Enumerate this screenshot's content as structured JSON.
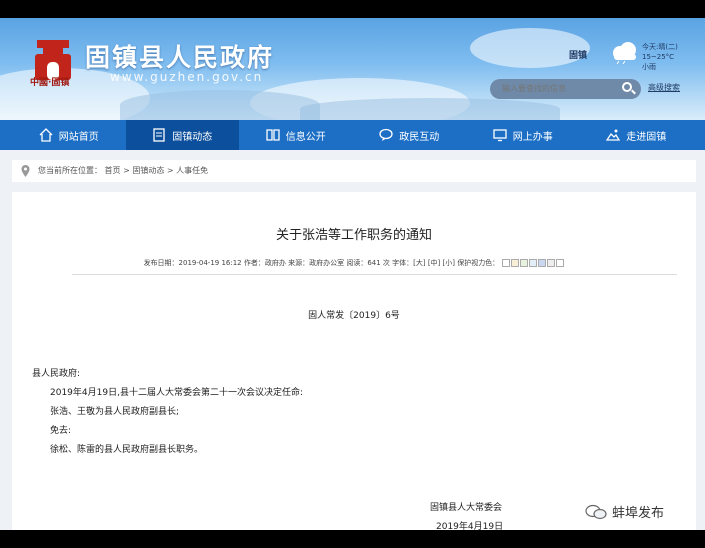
{
  "header": {
    "title": "固镇县人民政府",
    "url": "www.guzhen.gov.cn",
    "logo_tag": "中國·固镇",
    "county": "固镇",
    "weather": {
      "line1": "今天:晴(二)",
      "line2": "15~25°C",
      "line3": "小雨"
    },
    "search_placeholder": "输入要查找的信息",
    "advanced_search": "高级搜索"
  },
  "nav": [
    {
      "label": "网站首页",
      "icon": "home-icon"
    },
    {
      "label": "固镇动态",
      "icon": "news-icon",
      "active": true
    },
    {
      "label": "信息公开",
      "icon": "book-icon"
    },
    {
      "label": "政民互动",
      "icon": "chat-icon"
    },
    {
      "label": "网上办事",
      "icon": "monitor-icon"
    },
    {
      "label": "走进固镇",
      "icon": "landscape-icon"
    }
  ],
  "breadcrumb": "您当前所在位置： 首页 > 固镇动态 > 人事任免",
  "article": {
    "title": "关于张浩等工作职务的通知",
    "meta": "发布日期：2019-04-19 16:12  作者：政府办  来源：政府办公室  阅读：641 次  字体：[大] [中] [小]  保护视力色：",
    "doc_number": "固人常发〔2019〕6号",
    "salutation": "县人民政府:",
    "line1": "2019年4月19日,县十二届人大常委会第二十一次会议决定任命:",
    "line2": "张浩、王敬为县人民政府副县长;",
    "line3": "免去:",
    "line4": "徐松、陈雷的县人民政府副县长职务。",
    "signer": "固镇县人大常委会",
    "sign_date": "2019年4月19日"
  },
  "swatch_colors": [
    "#ffffff",
    "#f7efd6",
    "#e8f3df",
    "#e3eef9",
    "#c9d7f2",
    "#eeeeee",
    "#ffffff"
  ],
  "watermark": "蚌埠发布"
}
